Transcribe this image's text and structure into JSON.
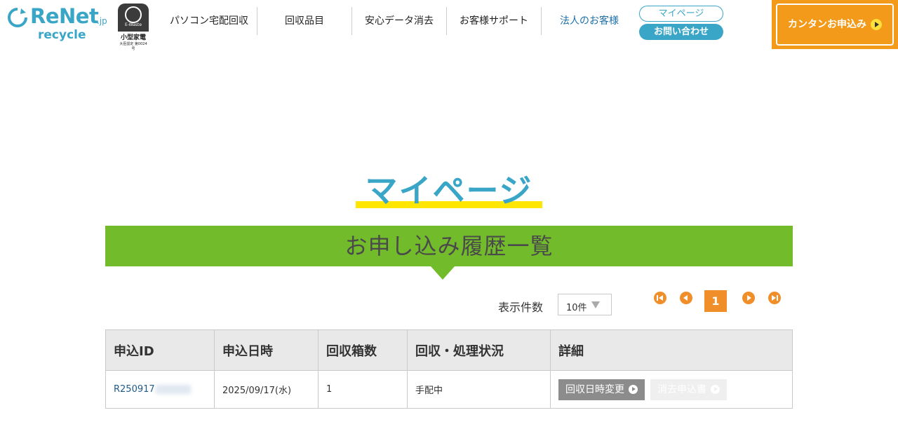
{
  "header": {
    "logo": {
      "name": "ReNet",
      "suffix": ".jp",
      "sub": "recycle"
    },
    "badge": {
      "mini": "E-Waste",
      "label": "小型家電",
      "cert": "大臣認定 第0024号"
    },
    "nav": [
      "パソコン宅配回収",
      "回収品目",
      "安心データ消去",
      "お客様サポート",
      "法人のお客様"
    ],
    "mypage": "マイページ",
    "contact": "お問い合わせ",
    "cta": "カンタンお申込み"
  },
  "page_title": "マイページ",
  "section_title": "お申し込み履歴一覧",
  "pagination": {
    "per_page_label": "表示件数",
    "per_page_value": "10件",
    "current_page": "1"
  },
  "table": {
    "headers": [
      "申込ID",
      "申込日時",
      "回収箱数",
      "回収・処理状況",
      "詳細"
    ],
    "rows": [
      {
        "id": "R250917",
        "date": "2025/09/17(水)",
        "boxes": "1",
        "status": "手配中",
        "change_btn": "回収日時変更",
        "delete_btn": "消去申込書"
      }
    ]
  },
  "colors": {
    "brand_blue": "#3aa6c7",
    "green": "#72bb2b",
    "orange": "#f08f2a",
    "cta_orange": "#f39a1a",
    "underline_yellow": "#ffe600"
  }
}
